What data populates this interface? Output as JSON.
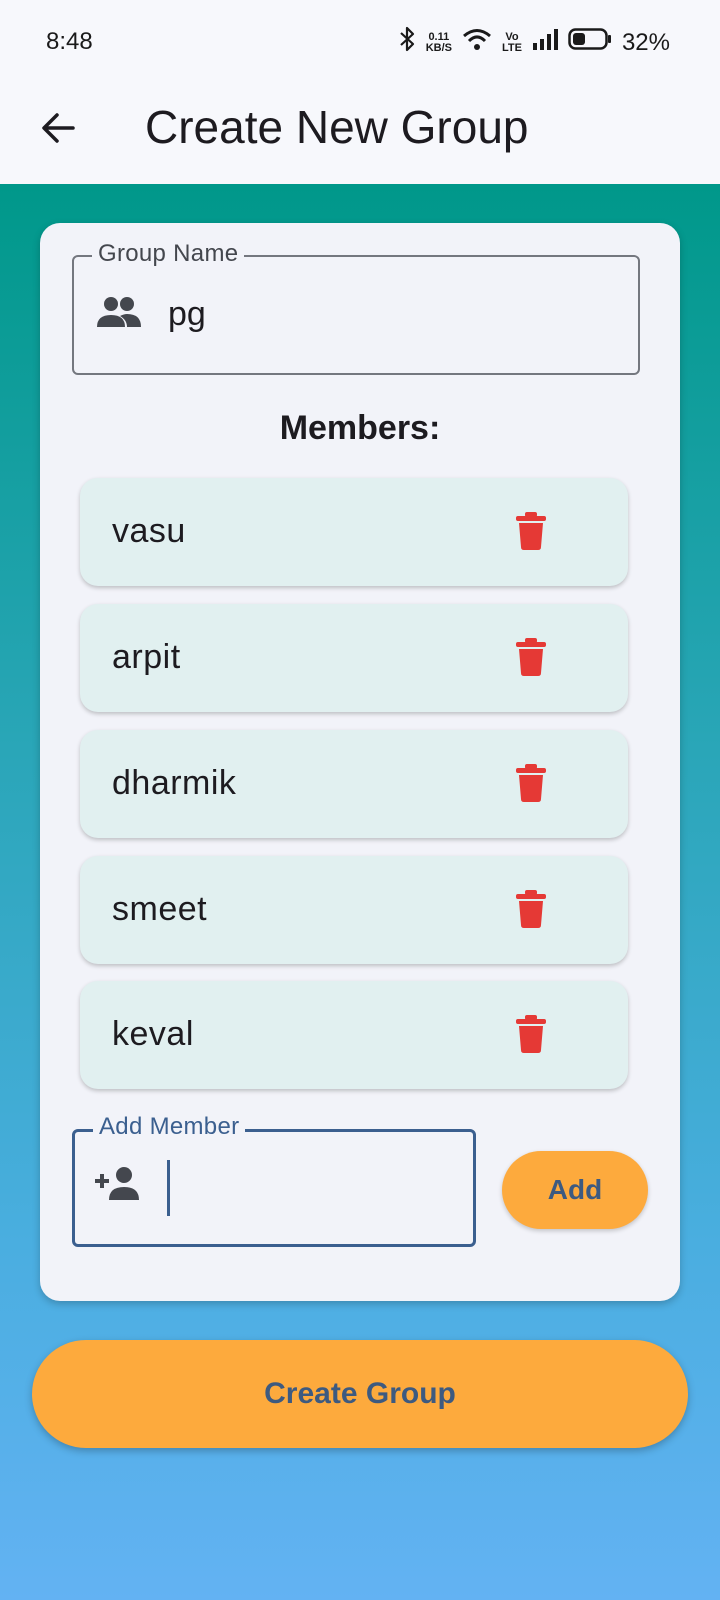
{
  "status_bar": {
    "time": "8:48",
    "net_speed_top": "0.11",
    "net_speed_bottom": "KB/S",
    "volte_top": "Vo",
    "volte_bottom": "LTE",
    "battery": "32%",
    "icons": [
      "bluetooth-icon",
      "wifi-icon",
      "signal-icon",
      "battery-icon"
    ]
  },
  "app_bar": {
    "title": "Create New Group",
    "back_icon": "arrow-back-icon"
  },
  "group_name": {
    "label": "Group Name",
    "value": "pg",
    "icon": "group-icon"
  },
  "members_title": "Members:",
  "members": [
    {
      "name": "vasu"
    },
    {
      "name": "arpit"
    },
    {
      "name": "dharmik"
    },
    {
      "name": "smeet"
    },
    {
      "name": "keval"
    }
  ],
  "add_member": {
    "label": "Add Member",
    "value": "",
    "icon": "person-add-icon",
    "button_label": "Add"
  },
  "create_button_label": "Create Group",
  "colors": {
    "accent": "#fdaa3d",
    "delete": "#e53935",
    "member_bg": "#e1f0f0",
    "gradient_top": "#00988a",
    "gradient_bottom": "#63b2f3"
  }
}
